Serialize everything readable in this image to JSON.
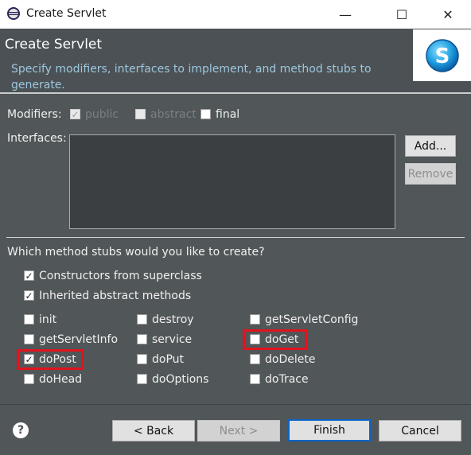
{
  "window": {
    "title": "Create Servlet",
    "controls": {
      "minimize": "—",
      "maximize": "☐",
      "close": "✕"
    }
  },
  "header": {
    "title": "Create Servlet",
    "description": "Specify modifiers, interfaces to implement, and method stubs to generate.",
    "logo_letter": "S"
  },
  "modifiers": {
    "label": "Modifiers:",
    "public": {
      "label": "public",
      "checked": true,
      "enabled": false
    },
    "abstract": {
      "label": "abstract",
      "checked": false,
      "enabled": false
    },
    "final": {
      "label": "final",
      "checked": false,
      "enabled": true
    }
  },
  "interfaces": {
    "label": "Interfaces:",
    "add_label": "Add...",
    "remove_label": "Remove"
  },
  "stubs": {
    "question": "Which method stubs would you like to create?",
    "constructors": {
      "label": "Constructors from superclass",
      "checked": true
    },
    "inherited": {
      "label": "Inherited abstract methods",
      "checked": true
    },
    "methods": {
      "init": {
        "label": "init",
        "checked": false
      },
      "destroy": {
        "label": "destroy",
        "checked": false
      },
      "getServletConfig": {
        "label": "getServletConfig",
        "checked": false
      },
      "getServletInfo": {
        "label": "getServletInfo",
        "checked": false
      },
      "service": {
        "label": "service",
        "checked": false
      },
      "doGet": {
        "label": "doGet",
        "checked": false
      },
      "doPost": {
        "label": "doPost",
        "checked": true
      },
      "doPut": {
        "label": "doPut",
        "checked": false
      },
      "doDelete": {
        "label": "doDelete",
        "checked": false
      },
      "doHead": {
        "label": "doHead",
        "checked": false
      },
      "doOptions": {
        "label": "doOptions",
        "checked": false
      },
      "doTrace": {
        "label": "doTrace",
        "checked": false
      }
    }
  },
  "footer": {
    "help": "?",
    "back_label": "< Back",
    "next_label": "Next >",
    "finish_label": "Finish",
    "cancel_label": "Cancel"
  },
  "check_mark": "✓",
  "colors": {
    "dialog_bg": "#515658",
    "header_bg": "#4b5155",
    "description_text": "#9ec6dc",
    "highlight": "#e0141f",
    "finish_border": "#0a64c8"
  }
}
